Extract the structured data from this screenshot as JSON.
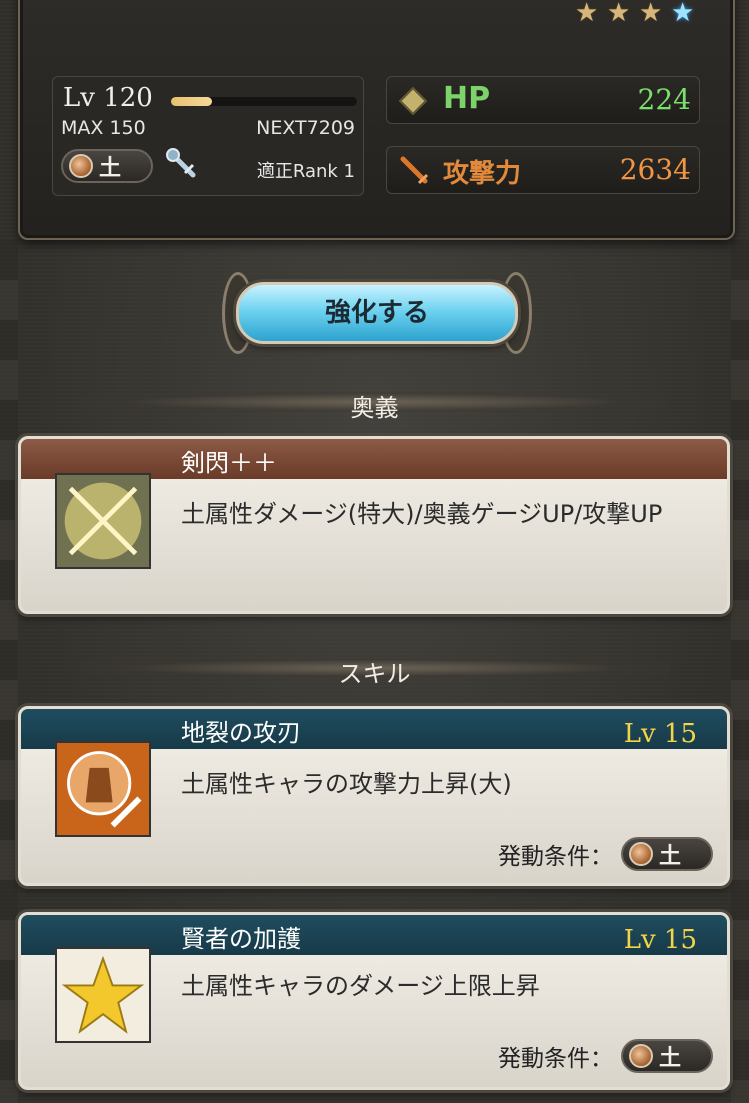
{
  "rarity": {
    "stars": [
      "gold",
      "gold",
      "gold",
      "blue"
    ]
  },
  "level": {
    "label": "Lv 120",
    "max": "MAX 150",
    "next": "NEXT7209",
    "exp_fraction": 0.22,
    "element": "土",
    "rank": "適正Rank 1"
  },
  "stats": {
    "hp_label": "HP",
    "hp_value": "224",
    "atk_label": "攻撃力",
    "atk_value": "2634"
  },
  "enhance_button": "強化する",
  "ougi": {
    "section_title": "奥義",
    "name": "剣閃＋＋",
    "description": "土属性ダメージ(特大)/奥義ゲージUP/攻撃UP"
  },
  "skills": {
    "section_title": "スキル",
    "condition_label": "発動条件：",
    "items": [
      {
        "name": "地裂の攻刃",
        "level": "Lv 15",
        "description": "土属性キャラの攻撃力上昇(大)",
        "element": "土"
      },
      {
        "name": "賢者の加護",
        "level": "Lv 15",
        "description": "土属性キャラのダメージ上限上昇",
        "element": "土"
      }
    ]
  },
  "colors": {
    "hp": "#7be06b",
    "atk": "#f09546",
    "level_gold": "#f3d447",
    "button_cyan": "#6fd3f0"
  }
}
